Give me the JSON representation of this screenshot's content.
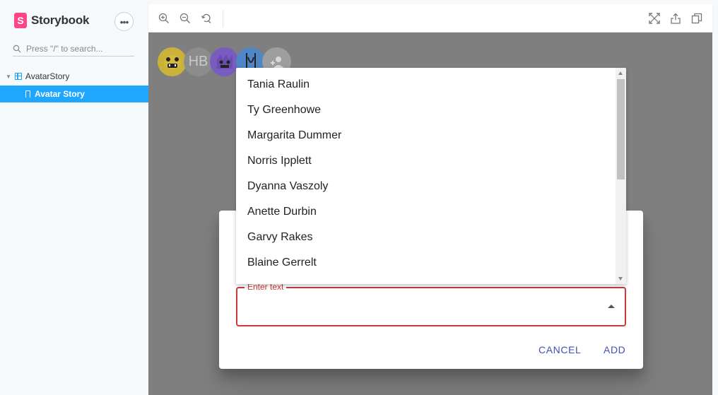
{
  "sidebar": {
    "brand": "Storybook",
    "brand_logo_letter": "S",
    "menu_icon": "ellipsis-icon",
    "search_placeholder": "Press \"/\" to search...",
    "group_label": "AvatarStory",
    "active_item": "Avatar Story"
  },
  "toolbar": {
    "left_icons": [
      "zoom-in-icon",
      "zoom-out-icon",
      "reset-zoom-icon"
    ],
    "right_icons": [
      "fullscreen-icon",
      "share-icon",
      "copy-icon"
    ]
  },
  "canvas": {
    "avatars": [
      {
        "kind": "image",
        "color": "#c9b13a"
      },
      {
        "kind": "initials",
        "text": "HB",
        "color": "#8c8c8c"
      },
      {
        "kind": "image",
        "color": "#7a5cc0"
      },
      {
        "kind": "image",
        "color": "#4f86c6"
      },
      {
        "kind": "add",
        "color": "#9e9e9e"
      }
    ]
  },
  "dialog": {
    "field_label": "Enter text",
    "field_value": "",
    "cancel_label": "CANCEL",
    "add_label": "ADD"
  },
  "dropdown": {
    "options": [
      "Tania Raulin",
      "Ty Greenhowe",
      "Margarita Dummer",
      "Norris Ipplett",
      "Dyanna Vaszoly",
      "Anette Durbin",
      "Garvy Rakes",
      "Blaine Gerrelt"
    ]
  },
  "colors": {
    "accent": "#1ea7fd",
    "brand": "#ff4785",
    "error": "#c93a3a",
    "primary_button": "#3f51b5"
  }
}
